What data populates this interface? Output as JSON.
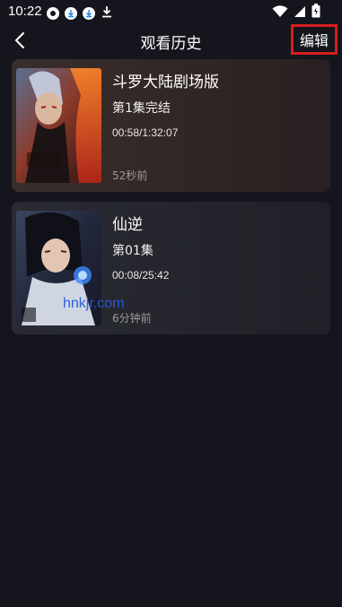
{
  "status_bar": {
    "time": "10:22",
    "left_icons": [
      "notification-badge-icon",
      "download-app-icon",
      "download-app-icon",
      "download-icon"
    ],
    "right_icons": [
      "wifi-icon",
      "signal-icon",
      "battery-icon"
    ]
  },
  "header": {
    "back_icon": "chevron-left-icon",
    "title": "观看历史",
    "edit_label": "编辑"
  },
  "history": [
    {
      "title": "斗罗大陆剧场版",
      "episode": "第1集完结",
      "progress": "00:58/1:32:07",
      "watched_ago": "52秒前"
    },
    {
      "title": "仙逆",
      "episode": "第01集",
      "progress": "00:08/25:42",
      "watched_ago": "6分钟前"
    }
  ],
  "watermark": "hnkjr.com",
  "colors": {
    "background": "#15151d",
    "highlight_border": "#d81e1e",
    "watermark": "#2b59d6"
  }
}
